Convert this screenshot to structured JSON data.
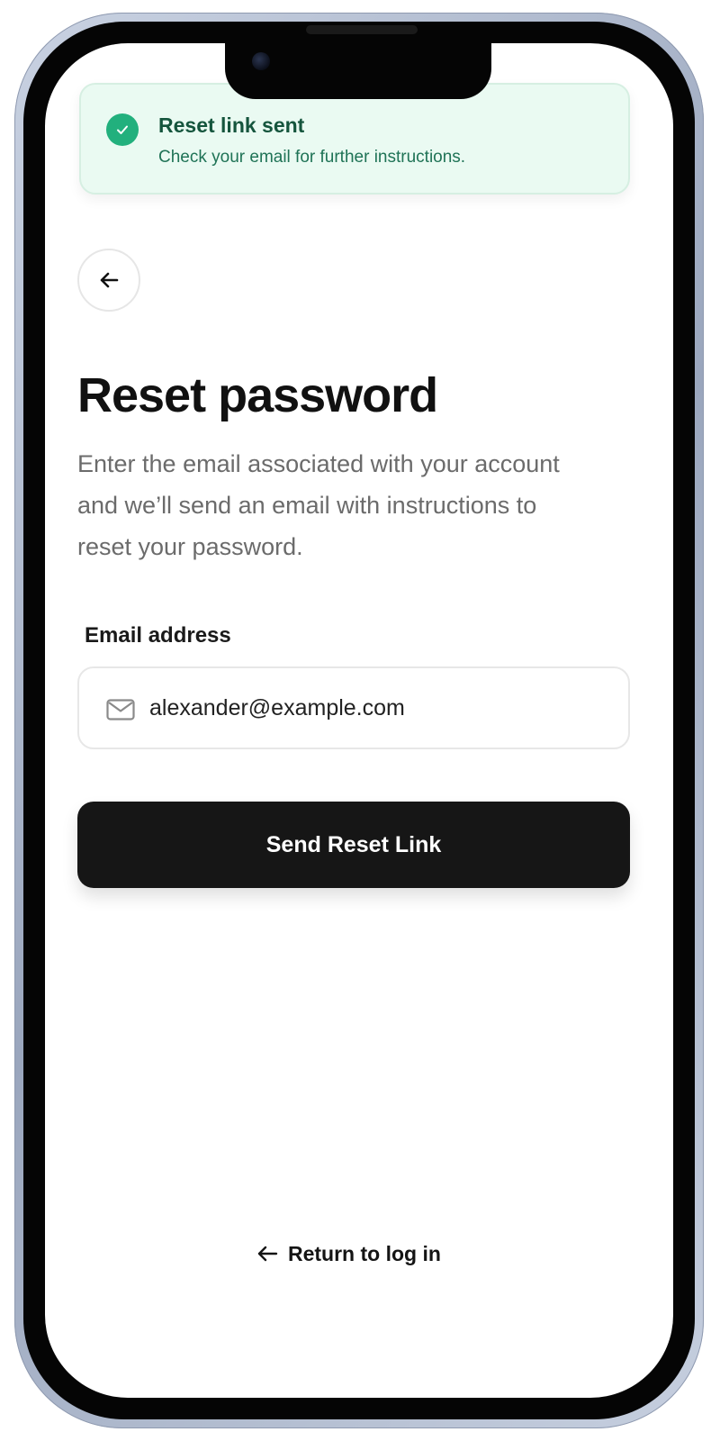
{
  "toast": {
    "title": "Reset link sent",
    "message": "Check your email for further instructions.",
    "icon": "check-icon",
    "accent_color": "#22b07d",
    "background_color": "#eafaf2"
  },
  "back_button": {
    "icon": "arrow-left-icon"
  },
  "page": {
    "title": "Reset password",
    "description": "Enter the email associated with your account and we’ll send an email with instructions to reset your password."
  },
  "email": {
    "label": "Email address",
    "value": "alexander@example.com",
    "icon": "mail-icon"
  },
  "actions": {
    "send_label": "Send Reset Link",
    "send_color": "#161616",
    "return_label": "Return to log in",
    "return_icon": "arrow-left-icon"
  }
}
